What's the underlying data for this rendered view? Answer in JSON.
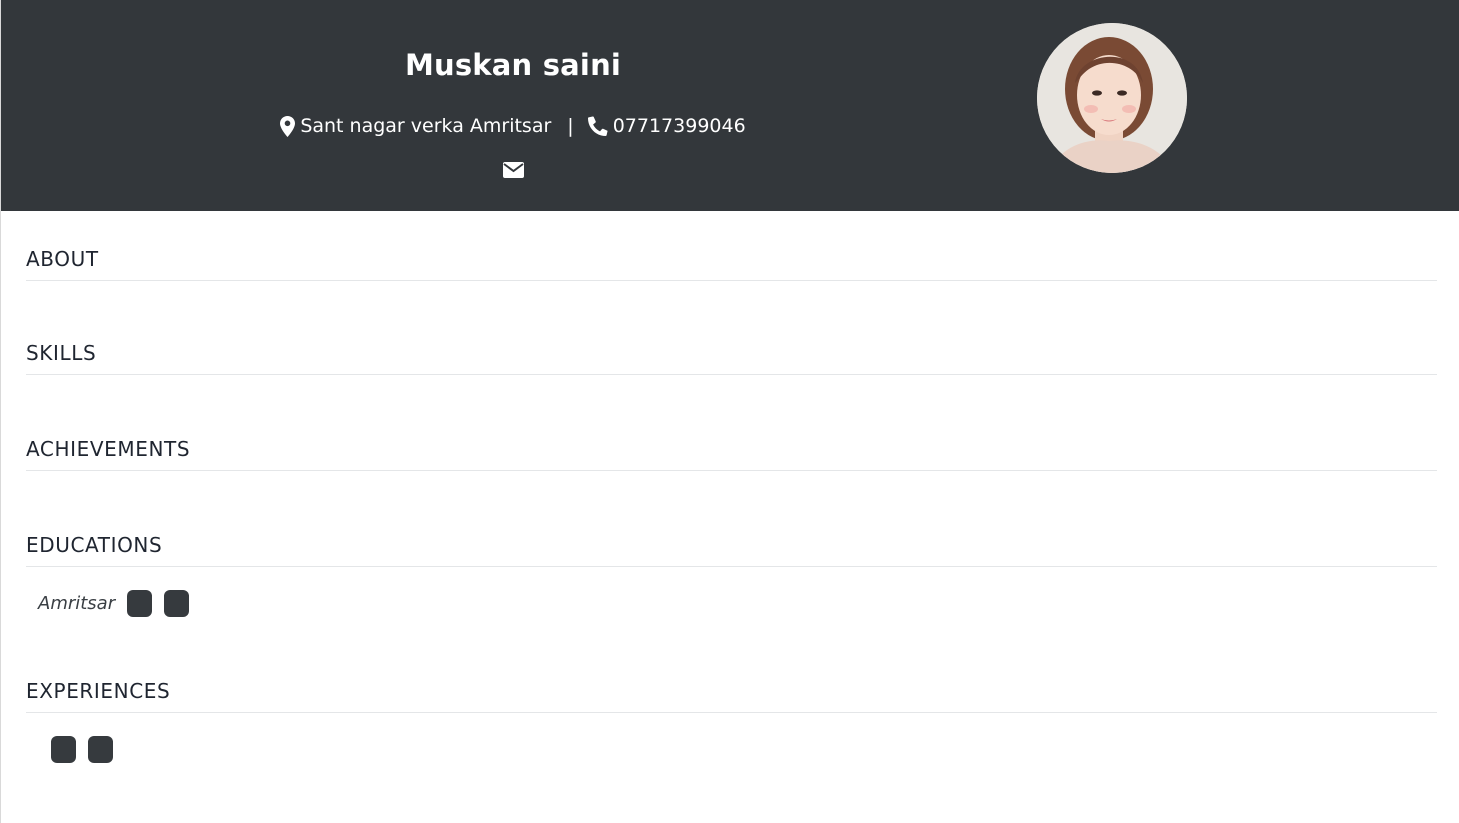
{
  "header": {
    "name": "Muskan saini",
    "address": "Sant nagar verka Amritsar",
    "separator": "|",
    "phone": "07717399046",
    "icons": {
      "location": "map-marker-icon",
      "phone": "phone-icon",
      "email": "envelope-icon"
    },
    "background_color": "#33373b"
  },
  "avatar": {
    "description_icon": "profile-photo"
  },
  "sections": {
    "about": {
      "title": "ABOUT"
    },
    "skills": {
      "title": "SKILLS"
    },
    "achievements": {
      "title": "ACHIEVEMENTS"
    },
    "educations": {
      "title": "EDUCATIONS",
      "items": [
        {
          "place": "Amritsar"
        }
      ]
    },
    "experiences": {
      "title": "EXPERIENCES"
    }
  }
}
